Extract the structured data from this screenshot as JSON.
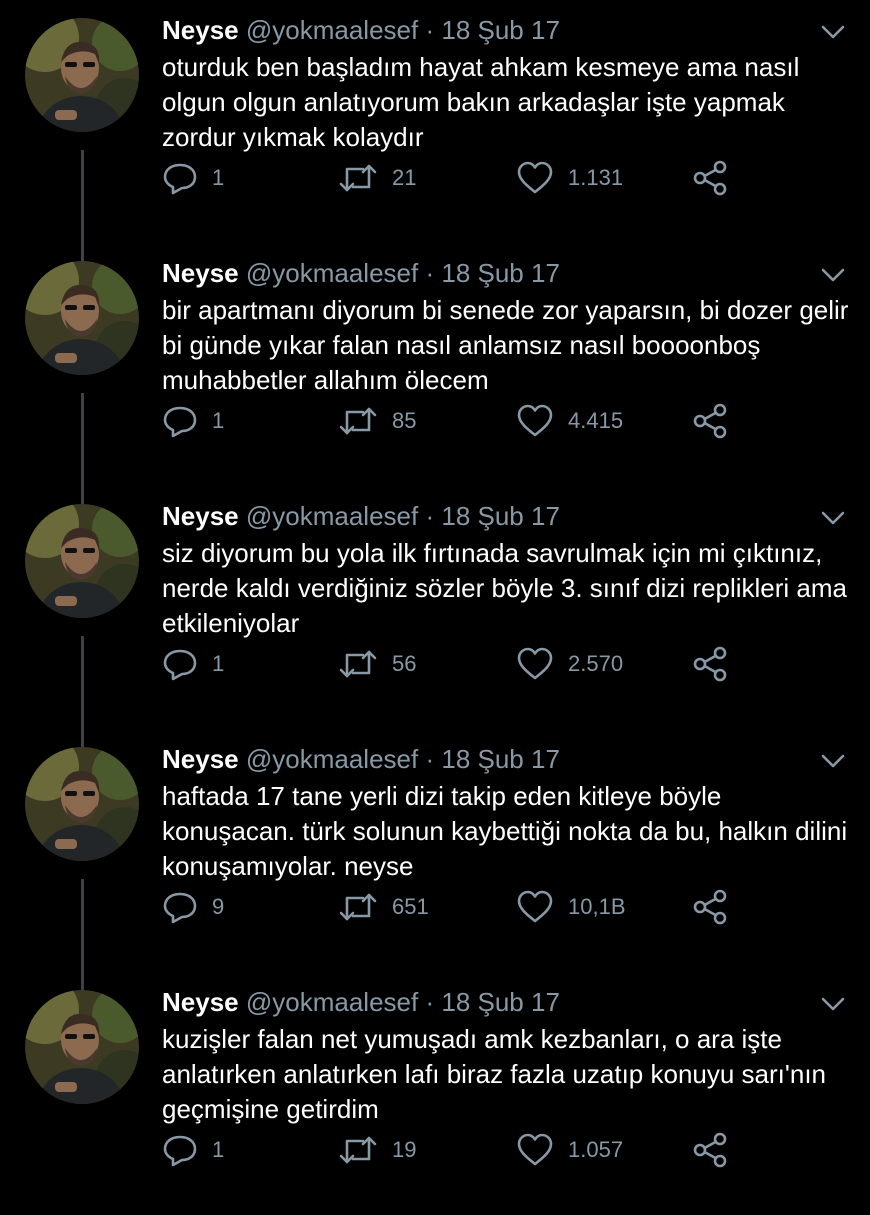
{
  "tweets": [
    {
      "name": "Neyse",
      "handle": "@yokmaalesef",
      "separator": "·",
      "date": "18 Şub 17",
      "text": "oturduk ben başladım hayat ahkam kesmeye ama nasıl olgun olgun anlatıyorum bakın arkadaşlar işte yapmak zordur yıkmak kolaydır",
      "replies": "1",
      "retweets": "21",
      "likes": "1.131"
    },
    {
      "name": "Neyse",
      "handle": "@yokmaalesef",
      "separator": "·",
      "date": "18 Şub 17",
      "text": "bir apartmanı diyorum bi senede zor yaparsın, bi dozer gelir bi günde yıkar falan nasıl anlamsız nasıl boooonboş muhabbetler allahım ölecem",
      "replies": "1",
      "retweets": "85",
      "likes": "4.415"
    },
    {
      "name": "Neyse",
      "handle": "@yokmaalesef",
      "separator": "·",
      "date": "18 Şub 17",
      "text": "siz diyorum bu yola ilk fırtınada savrulmak için mi çıktınız, nerde kaldı verdiğiniz sözler böyle 3. sınıf dizi replikleri ama etkileniyolar",
      "replies": "1",
      "retweets": "56",
      "likes": "2.570"
    },
    {
      "name": "Neyse",
      "handle": "@yokmaalesef",
      "separator": "·",
      "date": "18 Şub 17",
      "text": "haftada 17 tane yerli dizi takip eden kitleye böyle konuşacan. türk solunun kaybettiği nokta da bu, halkın dilini konuşamıyolar. neyse",
      "replies": "9",
      "retweets": "651",
      "likes": "10,1B"
    },
    {
      "name": "Neyse",
      "handle": "@yokmaalesef",
      "separator": "·",
      "date": "18 Şub 17",
      "text": "kuzişler falan net yumuşadı amk kezbanları, o ara işte anlatırken anlatırken lafı biraz fazla uzatıp konuyu sarı'nın geçmişine getirdim",
      "replies": "1",
      "retweets": "19",
      "likes": "1.057"
    }
  ],
  "icons": {
    "reply": "reply-icon",
    "retweet": "retweet-icon",
    "like": "heart-icon",
    "share": "share-icon",
    "menu": "chevron-down-icon"
  },
  "colors": {
    "background": "#000000",
    "text": "#ffffff",
    "muted": "#8899a6",
    "thread_line": "#38444d"
  }
}
